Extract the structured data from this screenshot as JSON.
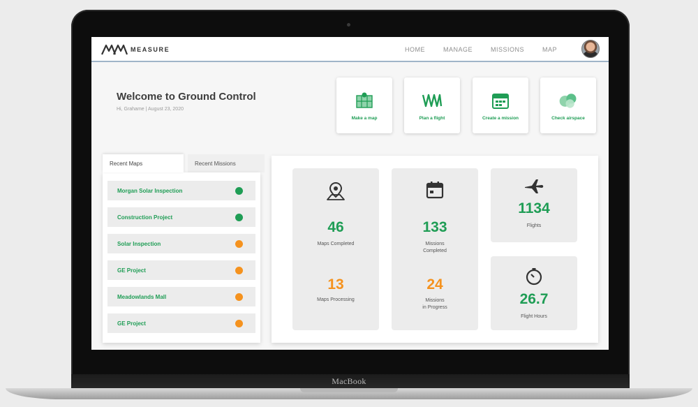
{
  "device": {
    "chin_label": "MacBook"
  },
  "navbar": {
    "logo_text": "MEASURE",
    "links": [
      "HOME",
      "MANAGE",
      "MISSIONS",
      "MAP"
    ]
  },
  "welcome": {
    "title": "Welcome to Ground Control",
    "subtitle": "Hi, Grahame | August 23, 2020"
  },
  "actions": [
    {
      "label": "Make a map",
      "icon": "map-grid-icon"
    },
    {
      "label": "Plan a flight",
      "icon": "flight-path-icon"
    },
    {
      "label": "Create a mission",
      "icon": "calendar-icon"
    },
    {
      "label": "Check airspace",
      "icon": "airspace-circles-icon"
    }
  ],
  "recent": {
    "tabs": [
      "Recent Maps",
      "Recent Missions"
    ],
    "active_tab": "Recent Maps",
    "maps": [
      {
        "name": "Morgan Solar Inspection",
        "status": "complete"
      },
      {
        "name": "Construction Project",
        "status": "complete"
      },
      {
        "name": "Solar Inspection",
        "status": "processing"
      },
      {
        "name": "GE Project",
        "status": "processing"
      },
      {
        "name": "Meadowlands Mall",
        "status": "processing"
      },
      {
        "name": "GE Project",
        "status": "processing"
      }
    ]
  },
  "stats": {
    "maps_completed": {
      "value": "46",
      "label": "Maps Completed"
    },
    "maps_processing": {
      "value": "13",
      "label": "Maps Processing"
    },
    "missions_completed": {
      "value": "133",
      "label_line1": "Missions",
      "label_line2": "Completed"
    },
    "missions_in_progress": {
      "value": "24",
      "label_line1": "Missions",
      "label_line2": "in Progress"
    },
    "flights": {
      "value": "1134",
      "label": "Flights"
    },
    "flight_hours": {
      "value": "26.7",
      "label": "Flight Hours"
    }
  },
  "colors": {
    "accent_green": "#1f9d55",
    "accent_orange": "#f5921e",
    "status_complete": "#1f9d55",
    "status_processing": "#f5921e"
  }
}
